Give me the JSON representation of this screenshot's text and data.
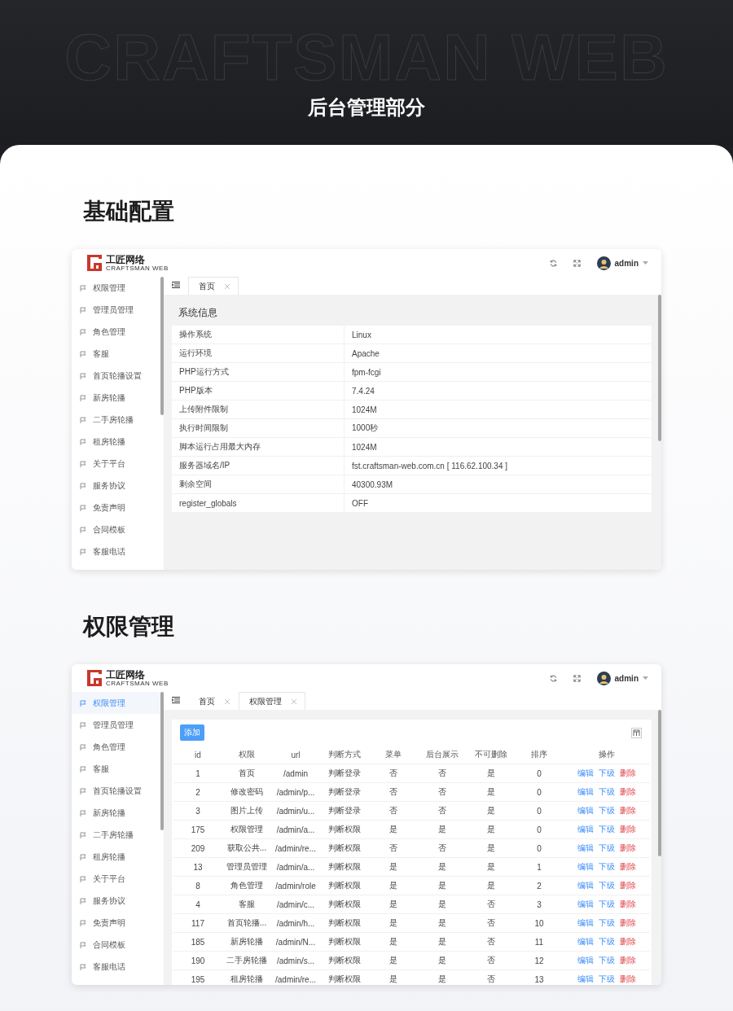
{
  "banner": {
    "backdrop_text": "CRAFTSMAN WEB",
    "title": "后台管理部分"
  },
  "sections": [
    {
      "heading": "基础配置",
      "screen": {
        "kind": "info",
        "brand": {
          "name": "工匠网络",
          "tagline": "CRAFTSMAN WEB"
        },
        "user": "admin",
        "sidebar": [
          {
            "label": "权限管理",
            "selected": false
          },
          {
            "label": "管理员管理",
            "selected": false
          },
          {
            "label": "角色管理",
            "selected": false
          },
          {
            "label": "客服",
            "selected": false
          },
          {
            "label": "首页轮播设置",
            "selected": false
          },
          {
            "label": "新房轮播",
            "selected": false
          },
          {
            "label": "二手房轮播",
            "selected": false
          },
          {
            "label": "租房轮播",
            "selected": false
          },
          {
            "label": "关于平台",
            "selected": false
          },
          {
            "label": "服务协议",
            "selected": false
          },
          {
            "label": "免责声明",
            "selected": false
          },
          {
            "label": "合同模板",
            "selected": false
          },
          {
            "label": "客服电话",
            "selected": false
          }
        ],
        "tabs": [
          {
            "label": "首页",
            "selected": true
          }
        ],
        "panel_title": "系统信息",
        "rows": [
          {
            "key": "操作系统",
            "value": "Linux"
          },
          {
            "key": "运行环境",
            "value": "Apache"
          },
          {
            "key": "PHP运行方式",
            "value": "fpm-fcgi"
          },
          {
            "key": "PHP版本",
            "value": "7.4.24"
          },
          {
            "key": "上传附件限制",
            "value": "1024M"
          },
          {
            "key": "执行时间限制",
            "value": "1000秒"
          },
          {
            "key": "脚本运行占用最大内存",
            "value": "1024M"
          },
          {
            "key": "服务器域名/IP",
            "value": "fst.craftsman-web.com.cn [ 116.62.100.34 ]"
          },
          {
            "key": "剩余空间",
            "value": "40300.93M"
          },
          {
            "key": "register_globals",
            "value": "OFF"
          }
        ]
      }
    },
    {
      "heading": "权限管理",
      "screen": {
        "kind": "table",
        "brand": {
          "name": "工匠网络",
          "tagline": "CRAFTSMAN WEB"
        },
        "user": "admin",
        "sidebar": [
          {
            "label": "权限管理",
            "selected": true
          },
          {
            "label": "管理员管理",
            "selected": false
          },
          {
            "label": "角色管理",
            "selected": false
          },
          {
            "label": "客服",
            "selected": false
          },
          {
            "label": "首页轮播设置",
            "selected": false
          },
          {
            "label": "新房轮播",
            "selected": false
          },
          {
            "label": "二手房轮播",
            "selected": false
          },
          {
            "label": "租房轮播",
            "selected": false
          },
          {
            "label": "关于平台",
            "selected": false
          },
          {
            "label": "服务协议",
            "selected": false
          },
          {
            "label": "免责声明",
            "selected": false
          },
          {
            "label": "合同模板",
            "selected": false
          },
          {
            "label": "客服电话",
            "selected": false
          }
        ],
        "tabs": [
          {
            "label": "首页",
            "selected": false
          },
          {
            "label": "权限管理",
            "selected": true
          }
        ],
        "add_button": "添加",
        "columns": [
          "id",
          "权限",
          "url",
          "判断方式",
          "菜单",
          "后台展示",
          "不可删除",
          "排序",
          "操作"
        ],
        "rows": [
          {
            "cells": [
              "1",
              "首页",
              "/admin",
              "判断登录",
              "否",
              "否",
              "是",
              "0"
            ],
            "actions": [
              {
                "label": "编辑",
                "kind": "edit"
              },
              {
                "label": "下级",
                "kind": "child"
              },
              {
                "label": "删除",
                "kind": "delete"
              }
            ]
          },
          {
            "cells": [
              "2",
              "修改密码",
              "/admin/p...",
              "判断登录",
              "否",
              "否",
              "是",
              "0"
            ],
            "actions": [
              {
                "label": "编辑",
                "kind": "edit"
              },
              {
                "label": "下级",
                "kind": "child"
              },
              {
                "label": "删除",
                "kind": "delete"
              }
            ]
          },
          {
            "cells": [
              "3",
              "图片上传",
              "/admin/u...",
              "判断登录",
              "否",
              "否",
              "是",
              "0"
            ],
            "actions": [
              {
                "label": "编辑",
                "kind": "edit"
              },
              {
                "label": "下级",
                "kind": "child"
              },
              {
                "label": "删除",
                "kind": "delete"
              }
            ]
          },
          {
            "cells": [
              "175",
              "权限管理",
              "/admin/a...",
              "判断权限",
              "是",
              "是",
              "是",
              "0"
            ],
            "actions": [
              {
                "label": "编辑",
                "kind": "edit"
              },
              {
                "label": "下级",
                "kind": "child"
              },
              {
                "label": "删除",
                "kind": "delete"
              }
            ]
          },
          {
            "cells": [
              "209",
              "获取公共...",
              "/admin/re...",
              "判断权限",
              "否",
              "否",
              "是",
              "0"
            ],
            "actions": [
              {
                "label": "编辑",
                "kind": "edit"
              },
              {
                "label": "下级",
                "kind": "child"
              },
              {
                "label": "删除",
                "kind": "delete"
              }
            ]
          },
          {
            "cells": [
              "13",
              "管理员管理",
              "/admin/a...",
              "判断权限",
              "是",
              "是",
              "是",
              "1"
            ],
            "actions": [
              {
                "label": "编辑",
                "kind": "edit"
              },
              {
                "label": "下级",
                "kind": "child"
              },
              {
                "label": "删除",
                "kind": "delete"
              }
            ]
          },
          {
            "cells": [
              "8",
              "角色管理",
              "/admin/role",
              "判断权限",
              "是",
              "是",
              "是",
              "2"
            ],
            "actions": [
              {
                "label": "编辑",
                "kind": "edit"
              },
              {
                "label": "下级",
                "kind": "child"
              },
              {
                "label": "删除",
                "kind": "delete"
              }
            ]
          },
          {
            "cells": [
              "4",
              "客服",
              "/admin/c...",
              "判断权限",
              "是",
              "是",
              "否",
              "3"
            ],
            "actions": [
              {
                "label": "编辑",
                "kind": "edit"
              },
              {
                "label": "下级",
                "kind": "child"
              },
              {
                "label": "删除",
                "kind": "delete"
              }
            ]
          },
          {
            "cells": [
              "117",
              "首页轮播...",
              "/admin/h...",
              "判断权限",
              "是",
              "是",
              "否",
              "10"
            ],
            "actions": [
              {
                "label": "编辑",
                "kind": "edit"
              },
              {
                "label": "下级",
                "kind": "child"
              },
              {
                "label": "删除",
                "kind": "delete"
              }
            ]
          },
          {
            "cells": [
              "185",
              "新房轮播",
              "/admin/N...",
              "判断权限",
              "是",
              "是",
              "否",
              "11"
            ],
            "actions": [
              {
                "label": "编辑",
                "kind": "edit"
              },
              {
                "label": "下级",
                "kind": "child"
              },
              {
                "label": "删除",
                "kind": "delete"
              }
            ]
          },
          {
            "cells": [
              "190",
              "二手房轮播",
              "/admin/s...",
              "判断权限",
              "是",
              "是",
              "否",
              "12"
            ],
            "actions": [
              {
                "label": "编辑",
                "kind": "edit"
              },
              {
                "label": "下级",
                "kind": "child"
              },
              {
                "label": "删除",
                "kind": "delete"
              }
            ]
          },
          {
            "cells": [
              "195",
              "租房轮播",
              "/admin/re...",
              "判断权限",
              "是",
              "是",
              "否",
              "13"
            ],
            "actions": [
              {
                "label": "编辑",
                "kind": "edit"
              },
              {
                "label": "下级",
                "kind": "child"
              },
              {
                "label": "删除",
                "kind": "delete"
              }
            ]
          }
        ]
      }
    }
  ]
}
